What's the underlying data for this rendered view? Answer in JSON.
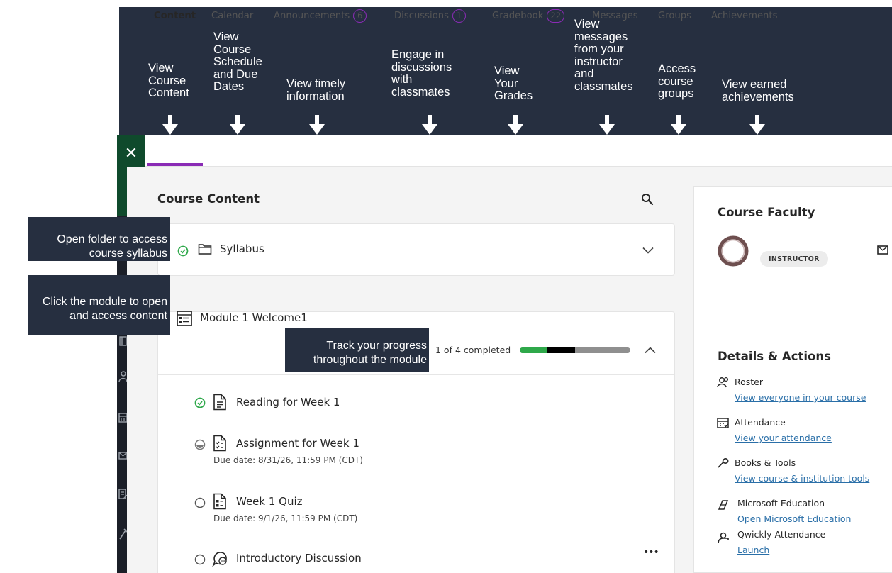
{
  "annotations_top": [
    {
      "text": "View\nCourse\nContent"
    },
    {
      "text": "View\nCourse\nSchedule\nand Due\nDates"
    },
    {
      "text": "View timely\ninformation"
    },
    {
      "text": "Engage in\ndiscussions\nwith\nclassmates"
    },
    {
      "text": "View\nYour\nGrades"
    },
    {
      "text": "View\nmessages\nfrom your\ninstructor\nand\nclassmates"
    },
    {
      "text": "Access\ncourse\ngroups"
    },
    {
      "text": "View earned\nachievements"
    }
  ],
  "annotations_side": {
    "syllabus": "Open folder to access\ncourse syllabus",
    "module": "Click the module to open\nand access content",
    "progress": "Track your progress\nthroughout the module"
  },
  "nav": {
    "close_glyph": "✕",
    "tabs": [
      {
        "label": "Content",
        "active": true
      },
      {
        "label": "Calendar"
      },
      {
        "label": "Announcements",
        "badge": "6"
      },
      {
        "label": "Discussions",
        "badge": "1"
      },
      {
        "label": "Gradebook",
        "badge": "22"
      },
      {
        "label": "Messages"
      },
      {
        "label": "Groups"
      },
      {
        "label": "Achievements"
      }
    ]
  },
  "content": {
    "title": "Course Content",
    "syllabus": {
      "title": "Syllabus"
    },
    "module": {
      "title": "Module 1 Welcome1",
      "progress_text": "1 of 4 completed",
      "progress": {
        "completed_fraction": 0.25,
        "in_progress_fraction": 0.25
      },
      "items": [
        {
          "title": "Reading for Week 1",
          "status": "completed",
          "due": ""
        },
        {
          "title": "Assignment for Week 1",
          "status": "in-progress",
          "due": "Due date: 8/31/26, 11:59 PM (CDT)"
        },
        {
          "title": "Week 1 Quiz",
          "status": "not-started",
          "due": "Due date: 9/1/26, 11:59 PM (CDT)"
        },
        {
          "title": "Introductory Discussion",
          "status": "not-started",
          "due": ""
        }
      ],
      "more_glyph": "•••"
    }
  },
  "faculty": {
    "title": "Course Faculty",
    "role": "INSTRUCTOR"
  },
  "details": {
    "title": "Details & Actions",
    "items": [
      {
        "label": "Roster",
        "link": "View everyone in your course",
        "icon": "roster-icon"
      },
      {
        "label": "Attendance",
        "link": "View your attendance",
        "icon": "attendance-icon"
      },
      {
        "label": "Books & Tools",
        "link": "View course & institution tools",
        "icon": "tools-icon"
      },
      {
        "label": "Microsoft Education",
        "link": "Open Microsoft Education",
        "icon": "microsoft-education-icon"
      },
      {
        "label": "Qwickly Attendance",
        "link": "Launch",
        "icon": "qwickly-icon"
      }
    ]
  },
  "colors": {
    "annotation_bg": "#262f40",
    "accent": "#8a2bb5",
    "success": "#2ea84a",
    "link": "#2a6fa8"
  }
}
